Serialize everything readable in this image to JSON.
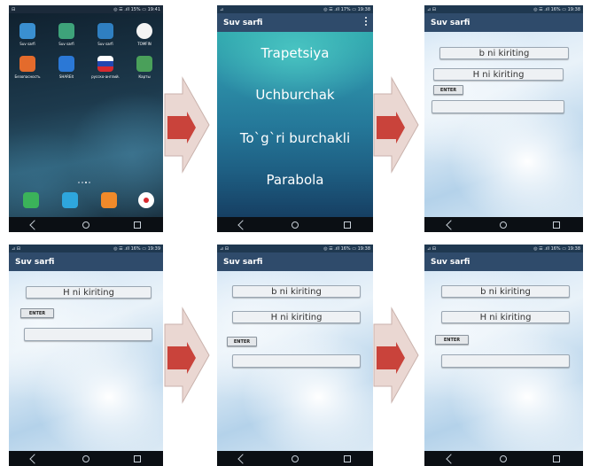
{
  "app_title": "Suv sarfi",
  "screens": {
    "home": {
      "status_left": "⊟",
      "status_right": "◎ ☰ .ıll 15% ▭ 19:41",
      "apps": [
        {
          "label": "Suv sarfi",
          "icon": "suv-sarfi-app-icon",
          "color": "#3a8fd0"
        },
        {
          "label": "Suv sarfi",
          "icon": "android-app-icon",
          "color": "#3ea37a"
        },
        {
          "label": "Suv sarfi",
          "icon": "water-drop-app-icon",
          "color": "#2f7fc1"
        },
        {
          "label": "TOMFIN",
          "icon": "tomfin-app-icon",
          "color": "#f4f4f4"
        },
        {
          "label": "Безопасность",
          "icon": "security-app-icon",
          "color": "#e46b2c"
        },
        {
          "label": "SHAREit",
          "icon": "shareit-app-icon",
          "color": "#2b78d6"
        },
        {
          "label": "русско-англий.",
          "icon": "flag-app-icon",
          "color": "#f0f0f0"
        },
        {
          "label": "Карты",
          "icon": "maps-app-icon",
          "color": "#4aa05a"
        }
      ],
      "dock": [
        {
          "icon": "phone-icon",
          "color": "#3bb35a"
        },
        {
          "icon": "messages-icon",
          "color": "#2ea6dd"
        },
        {
          "icon": "contacts-icon",
          "color": "#f08a2a"
        },
        {
          "icon": "camera-icon",
          "color": "#ffffff"
        }
      ]
    },
    "menu": {
      "status_left": "⊿",
      "status_right": "◎ ☰ .ıll 17% ▭ 19:38",
      "items": [
        "Trapetsiya",
        "Uchburchak",
        "To`g`ri burchakli",
        "Parabola"
      ]
    },
    "form_b_h": {
      "status_left": "⊿ ⊟",
      "status_right": "◎ ☰ .ıll 16% ▭ 19:38",
      "field1": "b ni kiriting",
      "field2": "H ni kiriting",
      "button": "ENTER"
    },
    "form_h": {
      "status_left": "⊿ ⊟",
      "status_right": "◎ ☰ .ıll 16% ▭ 19:39",
      "field1": "H ni kiriting",
      "button": "ENTER"
    },
    "form_b_h_2": {
      "status_left": "⊿ ⊟",
      "status_right": "◎ ☰ .ıll 16% ▭ 19:38",
      "field1": "b ni kiriting",
      "field2": "H ni kiriting",
      "button": "ENTER"
    },
    "form_b_h_3": {
      "status_left": "⊿ ⊟",
      "status_right": "◎ ☰ .ıll 16% ▭ 19:38",
      "field1": "b ni kiriting",
      "field2": "H ni kiriting",
      "button": "ENTER"
    }
  },
  "colors": {
    "arrow_red": "#c9433b",
    "arrow_shape": "#ead7d2",
    "title_bar": "#2f4b6b"
  }
}
